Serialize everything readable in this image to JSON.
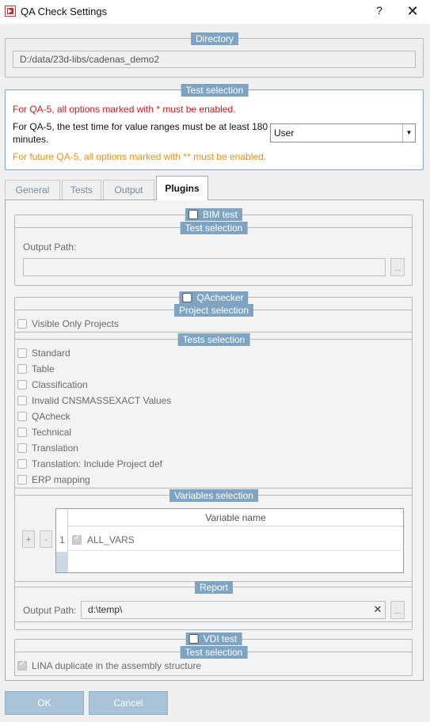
{
  "window": {
    "title": "QA Check Settings",
    "help": "?",
    "close": "✕"
  },
  "directory": {
    "title": "Directory",
    "value": "D:/data/23d-libs/cadenas_demo2"
  },
  "test_selection": {
    "title": "Test selection",
    "note_red": "For QA-5, all options marked with * must be enabled.",
    "note_time_line1": "For QA-5, the test time for value ranges must be at least 180",
    "note_time_line2": "minutes.",
    "dropdown_value": "User",
    "note_orange": "For future QA-5, all options marked with ** must be enabled."
  },
  "tabs": {
    "general": "General",
    "tests": "Tests",
    "output": "Output",
    "plugins": "Plugins"
  },
  "bim": {
    "title": "BIM test",
    "sub_title": "Test selection",
    "output_label": "Output Path:",
    "output_value": "",
    "browse": "..."
  },
  "qachecker": {
    "title": "QAchecker",
    "project_title": "Project selection",
    "visible_only": "Visible Only Projects",
    "tests_title": "Tests selection",
    "tests": [
      "Standard",
      "Table",
      "Classification",
      "Invalid CNSMASSEXACT Values",
      "QAcheck",
      "Technical",
      "Translation",
      "Translation: Include Project def",
      "ERP mapping"
    ],
    "variables_title": "Variables selection",
    "plus": "+",
    "minus": "-",
    "column_header": "Variable name",
    "row_number": "1",
    "row_value": "ALL_VARS",
    "report_title": "Report",
    "report_label": "Output Path:",
    "report_value": "d:\\temp\\",
    "clear": "✕",
    "browse": "..."
  },
  "vdi": {
    "title": "VDI test",
    "sub_title": "Test selection",
    "lina": "LINA duplicate in the assembly structure"
  },
  "buttons": {
    "ok": "OK",
    "cancel": "Cancel"
  },
  "colors": {
    "accent": "#7ea4c1",
    "red_note": "#d0181a",
    "orange_note": "#e69012",
    "primary_button": "#a8c3d7"
  }
}
